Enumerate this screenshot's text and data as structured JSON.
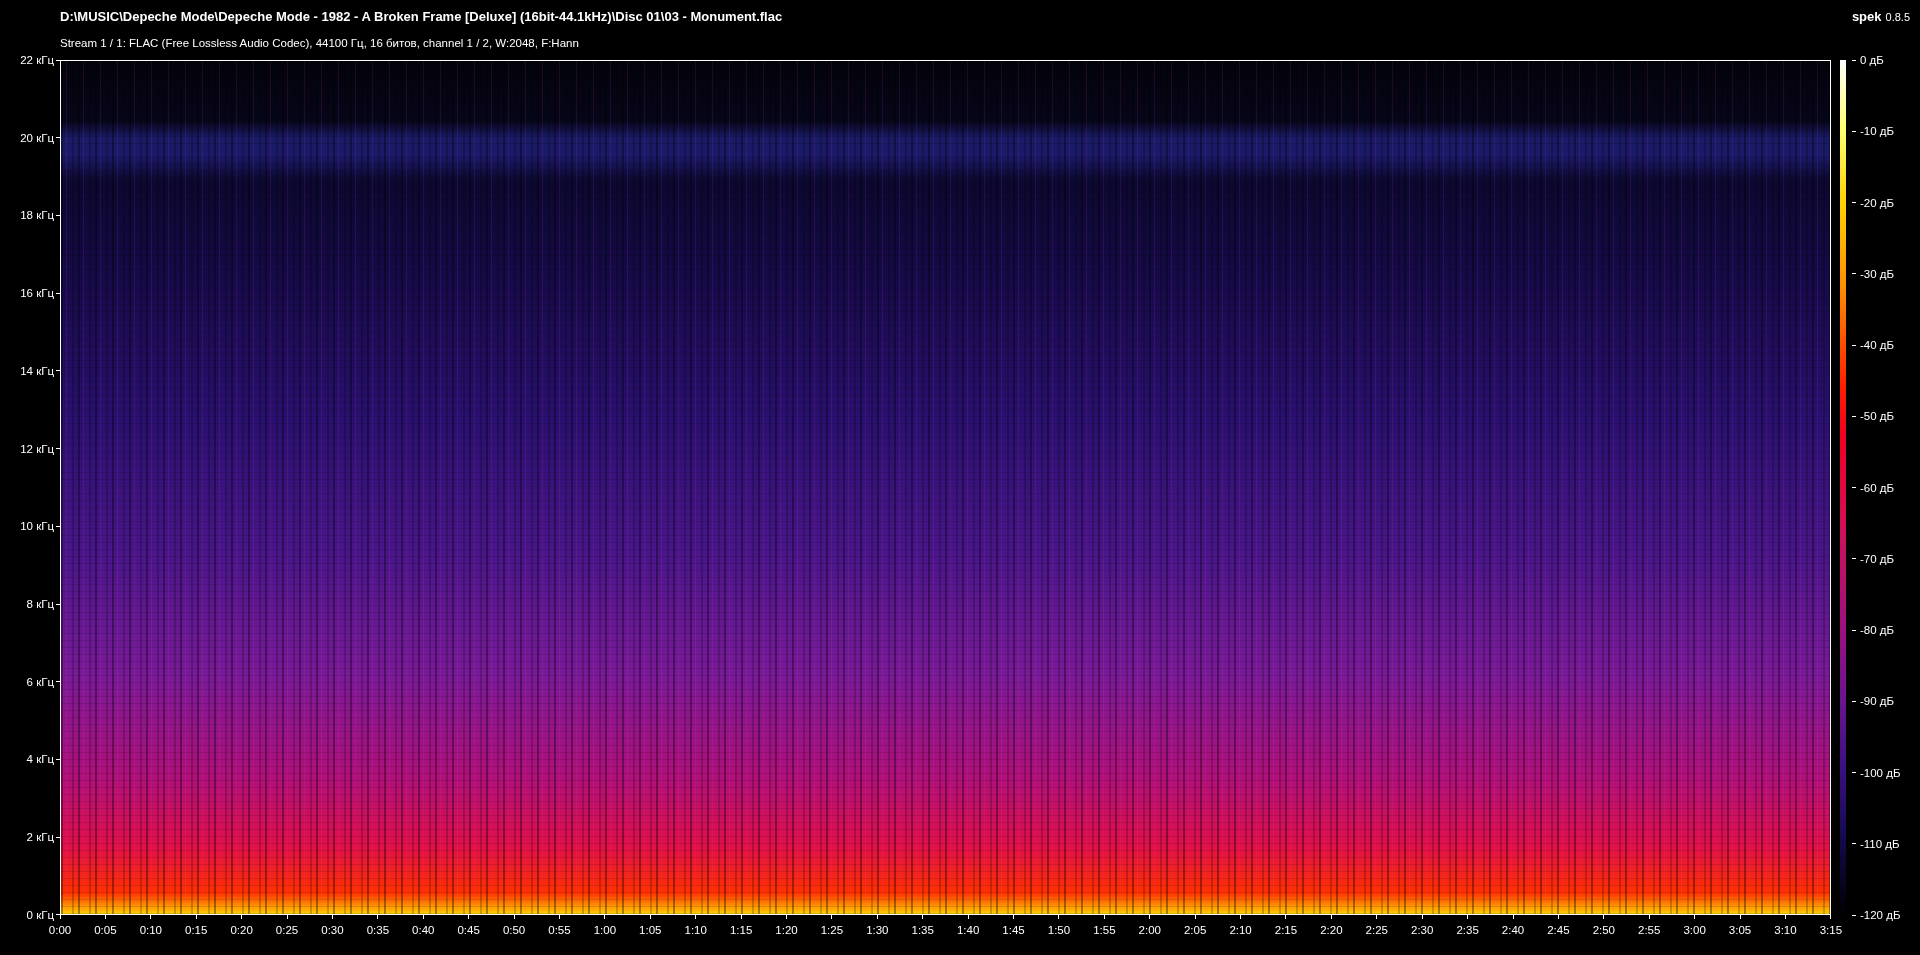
{
  "header": {
    "file_path": "D:\\MUSIC\\Depeche Mode\\Depeche Mode - 1982 - A Broken Frame [Deluxe] (16bit-44.1kHz)\\Disc 01\\03 - Monument.flac",
    "stream_info": "Stream 1 / 1: FLAC (Free Lossless Audio Codec), 44100 Гц, 16 битов, channel 1 / 2, W:2048, F:Hann",
    "app_name": "spek",
    "app_version": "0.8.5"
  },
  "spectrogram": {
    "frequency_ticks": [
      "22 кГц",
      "20 кГц",
      "18 кГц",
      "16 кГц",
      "14 кГц",
      "12 кГц",
      "10 кГц",
      "8 кГц",
      "6 кГц",
      "4 кГц",
      "2 кГц",
      "0 кГц"
    ],
    "time_ticks": [
      "0:00",
      "0:05",
      "0:10",
      "0:15",
      "0:20",
      "0:25",
      "0:30",
      "0:35",
      "0:40",
      "0:45",
      "0:50",
      "0:55",
      "1:00",
      "1:05",
      "1:10",
      "1:15",
      "1:20",
      "1:25",
      "1:30",
      "1:35",
      "1:40",
      "1:45",
      "1:50",
      "1:55",
      "2:00",
      "2:05",
      "2:10",
      "2:15",
      "2:20",
      "2:25",
      "2:30",
      "2:35",
      "2:40",
      "2:45",
      "2:50",
      "2:55",
      "3:00",
      "3:05",
      "3:10",
      "3:15"
    ]
  },
  "color_scale": {
    "ticks": [
      "0 дБ",
      "-10 дБ",
      "-20 дБ",
      "-30 дБ",
      "-40 дБ",
      "-50 дБ",
      "-60 дБ",
      "-70 дБ",
      "-80 дБ",
      "-90 дБ",
      "-100 дБ",
      "-110 дБ",
      "-120 дБ"
    ]
  }
}
